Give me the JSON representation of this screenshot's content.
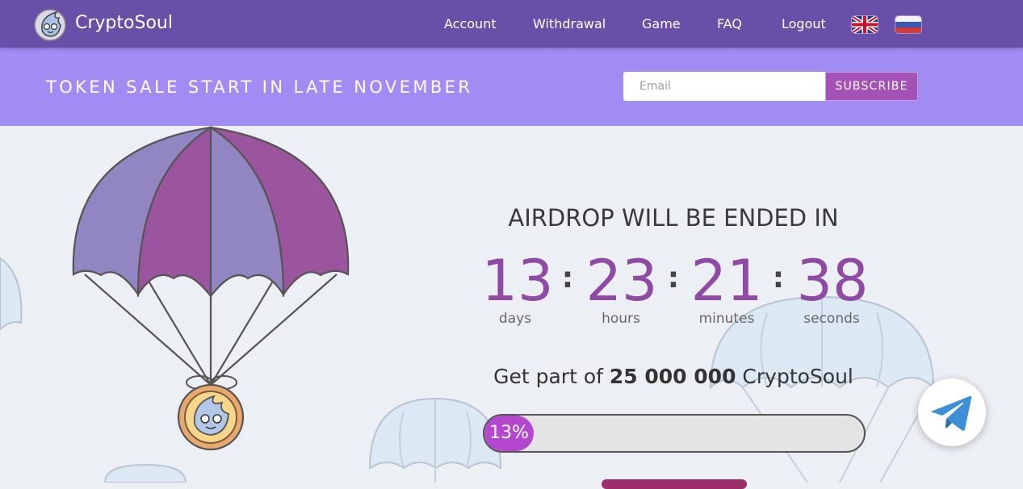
{
  "header": {
    "brand": "CryptoSoul",
    "nav": [
      "Account",
      "Withdrawal",
      "Game",
      "FAQ",
      "Logout"
    ],
    "languages": [
      "english-flag-icon",
      "russian-flag-icon"
    ],
    "bg_color": "#6a4fa8"
  },
  "promo": {
    "title": "TOKEN SALE START IN LATE NOVEMBER",
    "email_placeholder": "Email",
    "subscribe_label": "SUBSCRIBE",
    "bg_color": "#a18cf4"
  },
  "airdrop": {
    "title": "AIRDROP WILL BE ENDED IN",
    "countdown": [
      {
        "value": "13",
        "unit": "days"
      },
      {
        "value": "23",
        "unit": "hours"
      },
      {
        "value": "21",
        "unit": "minutes"
      },
      {
        "value": "38",
        "unit": "seconds"
      }
    ],
    "get_part_prefix": "Get part of",
    "get_part_amount": "25 000 000",
    "get_part_suffix": "CryptoSoul",
    "progress_label": "13%",
    "progress_fraction": 0.13,
    "accent_color": "#8e4aa5"
  },
  "widgets": {
    "telegram_icon": "telegram-icon"
  }
}
